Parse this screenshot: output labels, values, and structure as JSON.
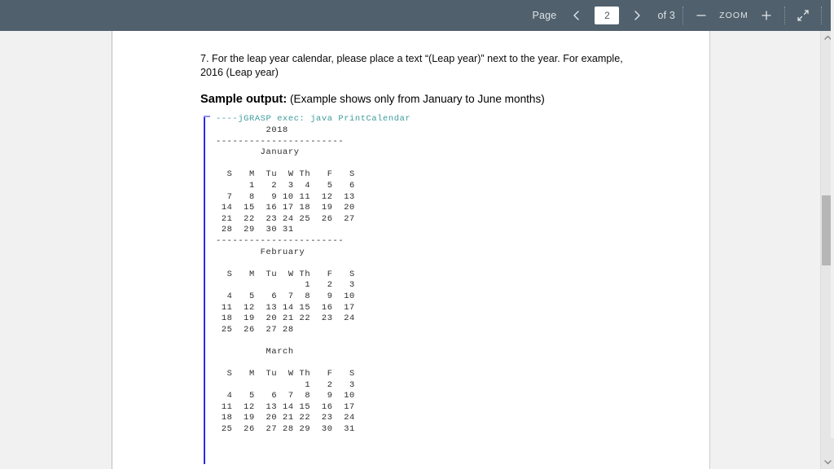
{
  "toolbar": {
    "page_label": "Page",
    "prev_icon": "chevron-left-icon",
    "page_value": "2",
    "next_icon": "chevron-right-icon",
    "of_label": "of 3",
    "zoom_out_label": "—",
    "zoom_label": "ZOOM",
    "zoom_in_label": "+",
    "collapse_icon": "collapse-fullscreen-icon",
    "background_color": "#50606d",
    "text_color": "#dfe3e6"
  },
  "document": {
    "paragraph": "7. For the leap year calendar, please place a text “(Leap year)” next to the year. For example, 2016 (Leap year)",
    "heading_strong": "Sample output:",
    "heading_rest": " (Example shows only from January to June months)",
    "console": {
      "exec_line": "----jGRASP exec: java PrintCalendar",
      "accent_color": "#3e9a9a",
      "rule_color": "#2a2aee",
      "body": "\n         2018\n-----------------------\n        January\n\n  S   M  Tu  W Th   F   S\n      1   2  3  4   5   6\n  7   8   9 10 11  12  13\n 14  15  16 17 18  19  20\n 21  22  23 24 25  26  27\n 28  29  30 31\n-----------------------\n        February\n\n  S   M  Tu  W Th   F   S\n                1   2   3\n  4   5   6  7  8   9  10\n 11  12  13 14 15  16  17\n 18  19  20 21 22  23  24\n 25  26  27 28\n\n         March\n\n  S   M  Tu  W Th   F   S\n                1   2   3\n  4   5   6  7  8   9  10\n 11  12  13 14 15  16  17\n 18  19  20 21 22  23  24\n 25  26  27 28 29  30  31"
    }
  },
  "scrollbar": {
    "up_icon": "chevron-up-icon",
    "down_icon": "chevron-down-icon",
    "thumb_color": "#b6b6b6"
  }
}
